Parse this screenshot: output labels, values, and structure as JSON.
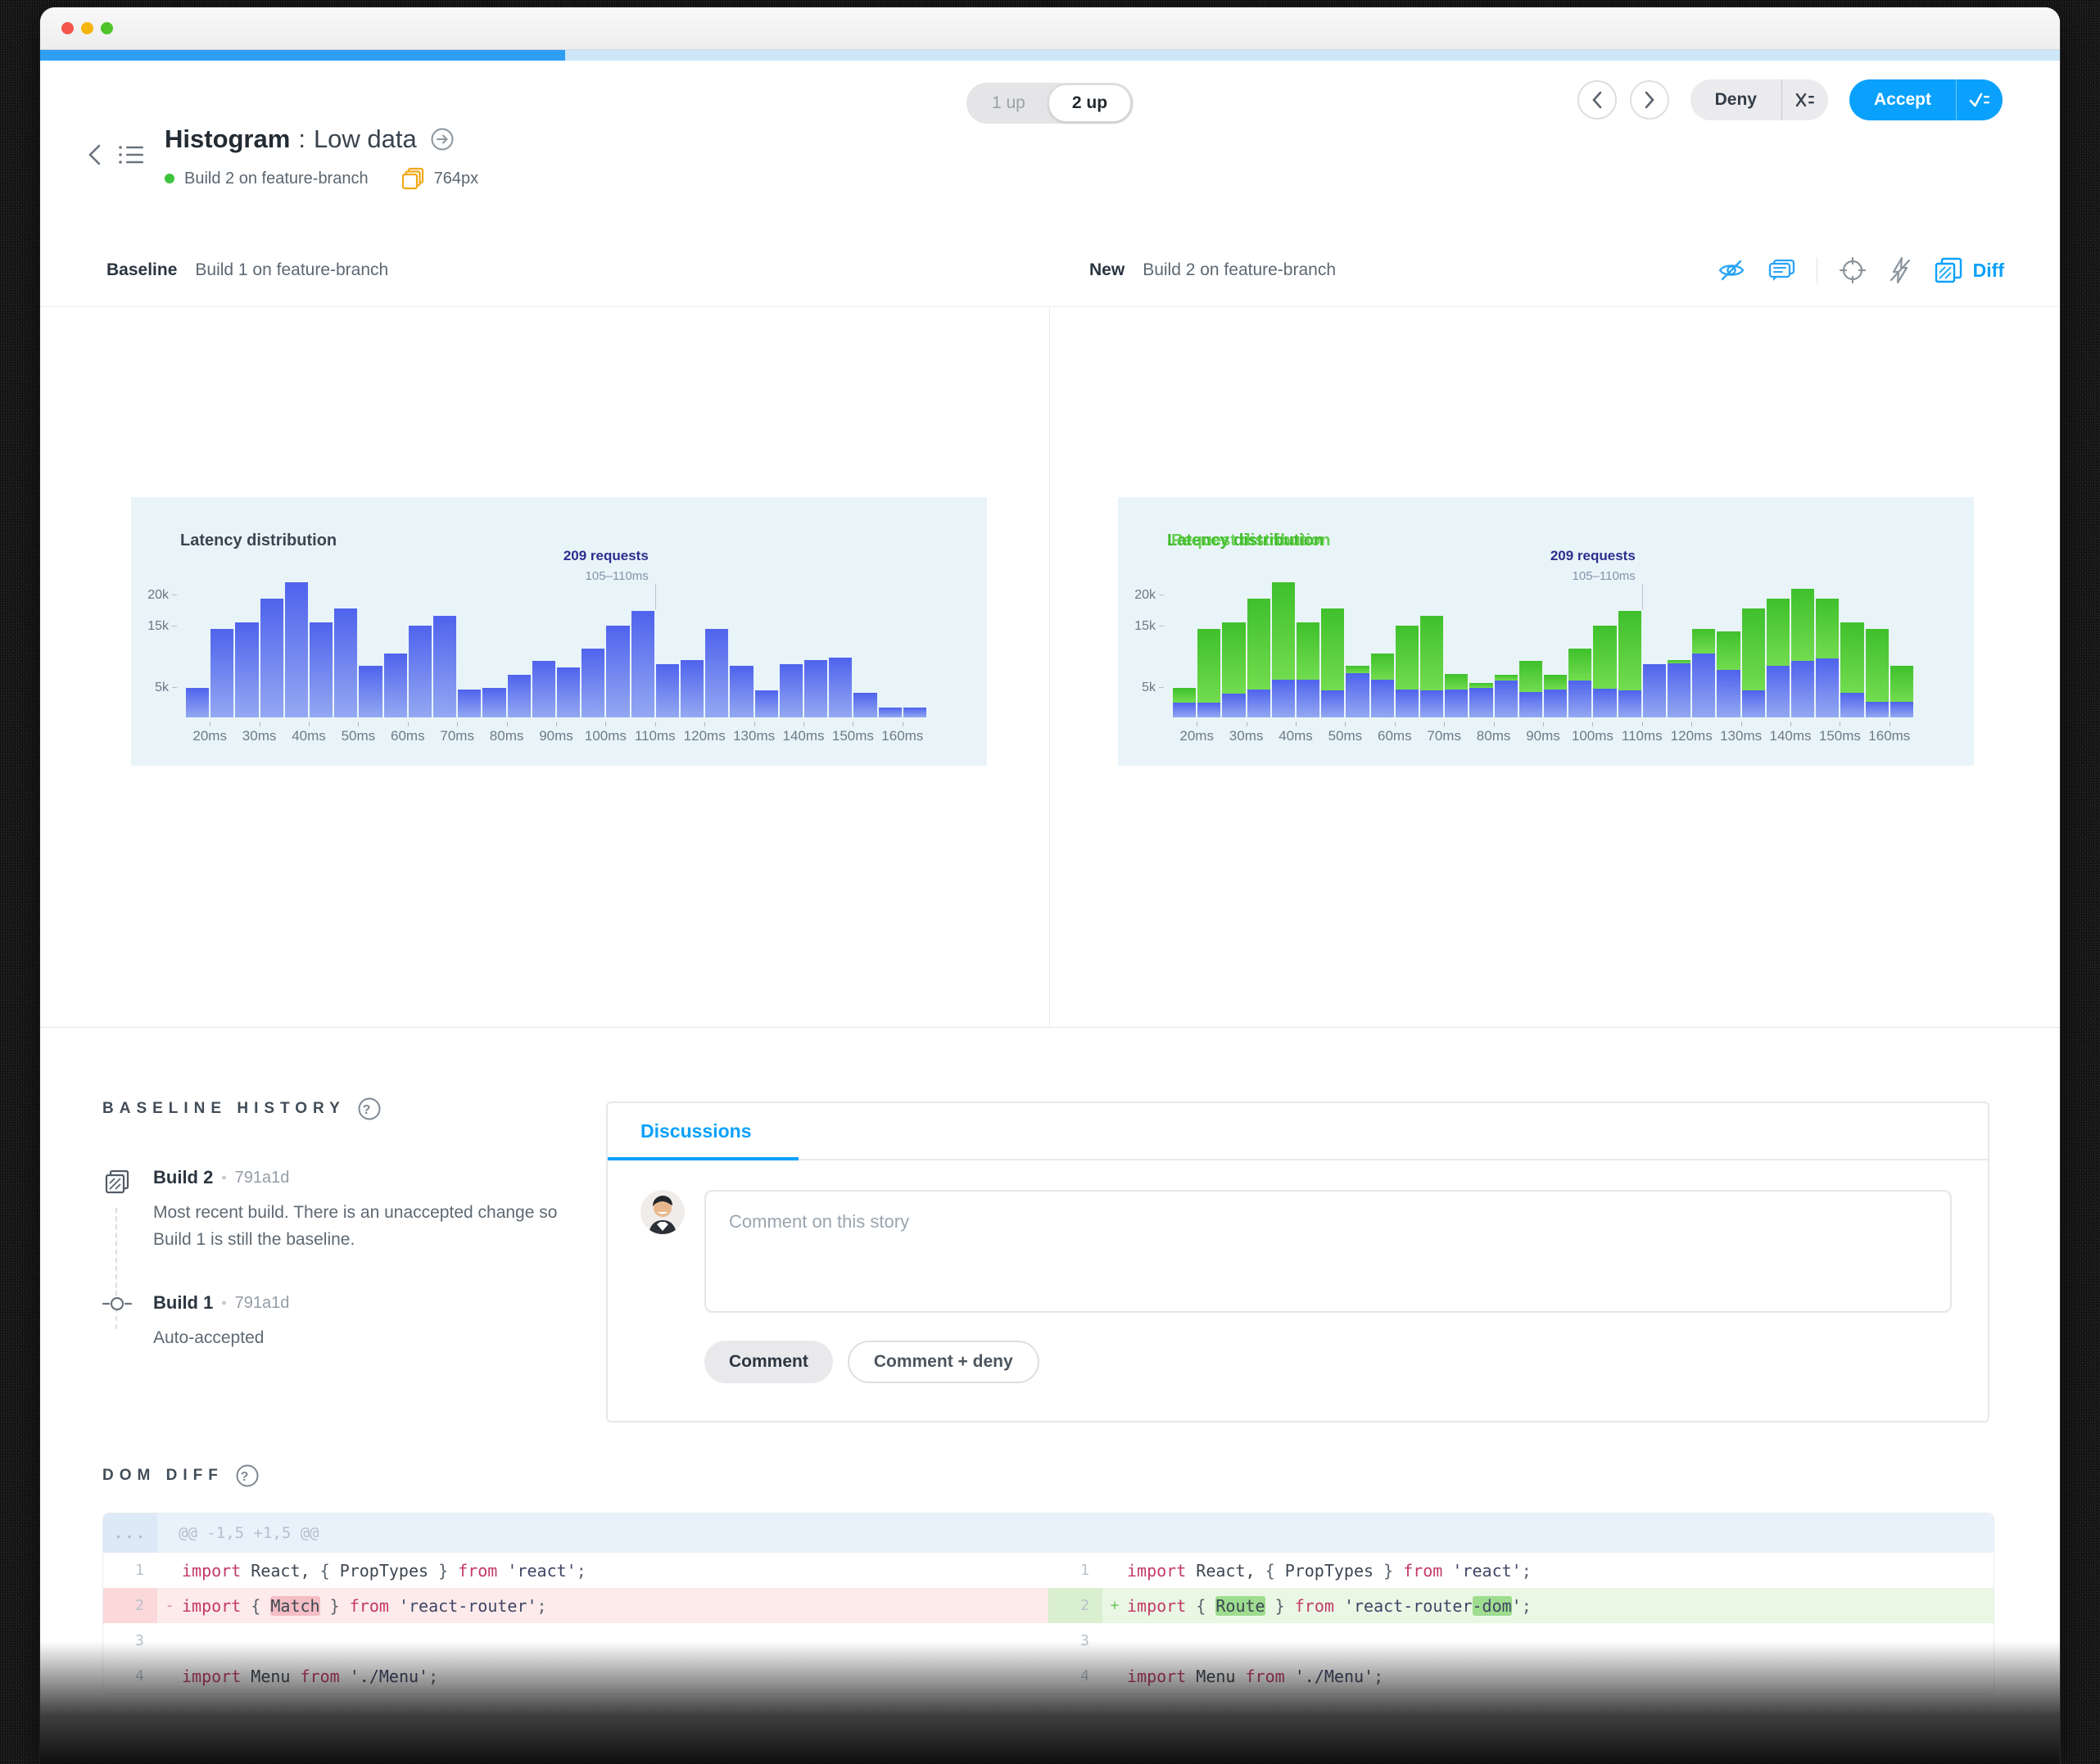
{
  "window": {
    "progress_percent": 26
  },
  "header": {
    "title": "Histogram",
    "separator": ":",
    "variant": "Low data",
    "build_label": "Build 2 on feature-branch",
    "width_label": "764px",
    "toggle": {
      "options": [
        "1 up",
        "2 up"
      ],
      "selected": "2 up"
    },
    "deny_label": "Deny",
    "accept_label": "Accept"
  },
  "compare": {
    "baseline": {
      "label": "Baseline",
      "build": "Build 1 on feature-branch"
    },
    "new": {
      "label": "New",
      "build": "Build 2 on feature-branch"
    },
    "diff_label": "Diff"
  },
  "chart_data": [
    {
      "type": "bar",
      "title": "Latency distribution",
      "x_start_ms": 15,
      "bin_width_ms": 5,
      "x_tick_labels": [
        "20ms",
        "30ms",
        "40ms",
        "50ms",
        "60ms",
        "70ms",
        "80ms",
        "90ms",
        "100ms",
        "110ms",
        "120ms",
        "130ms",
        "140ms",
        "150ms",
        "160ms"
      ],
      "y_ticks": [
        {
          "label": "20k",
          "value": 20
        },
        {
          "label": "15k",
          "value": 15
        },
        {
          "label": "5k",
          "value": 5
        }
      ],
      "ylim_k": [
        0,
        23
      ],
      "values_k": [
        4.8,
        14.4,
        15.5,
        19.4,
        22,
        15.5,
        17.8,
        8.4,
        10.4,
        14.9,
        16.5,
        4.5,
        4.8,
        7,
        9.2,
        8.1,
        11.2,
        14.9,
        17.3,
        8.7,
        9.3,
        14.4,
        8.4,
        4.4,
        8.7,
        9.3,
        9.7,
        4,
        1.6,
        1.6
      ],
      "annotation": {
        "label": "209 requests",
        "sublabel": "105–110ms",
        "bar_index": 18
      }
    },
    {
      "type": "stacked-bar",
      "title": "Latency distribution",
      "title_overlay": "Request distribution",
      "x_start_ms": 15,
      "bin_width_ms": 5,
      "x_tick_labels": [
        "20ms",
        "30ms",
        "40ms",
        "50ms",
        "60ms",
        "70ms",
        "80ms",
        "90ms",
        "100ms",
        "110ms",
        "120ms",
        "130ms",
        "140ms",
        "150ms",
        "160ms"
      ],
      "y_ticks": [
        {
          "label": "20k",
          "value": 20
        },
        {
          "label": "15k",
          "value": 15
        },
        {
          "label": "5k",
          "value": 5
        }
      ],
      "ylim_k": [
        0,
        23
      ],
      "series": [
        {
          "name": "new-build-bars",
          "color_key": "bar_blue",
          "base_k": [
            2.4,
            2.4,
            3.9,
            4.6,
            6.1,
            6.1,
            4.4,
            7.2,
            6.1,
            4.6,
            4.4,
            4.5,
            4.8,
            6,
            4.1,
            4.6,
            6,
            4.7,
            4.4,
            8.7,
            8.8,
            10.4,
            7.8,
            4.4,
            8.4,
            9.2,
            9.6,
            4,
            2.6,
            2.6
          ]
        },
        {
          "name": "diff-highlight",
          "color_key": "diff_green",
          "totals_k": [
            4.8,
            14.4,
            15.5,
            19.4,
            22,
            15.5,
            17.8,
            8.4,
            10.4,
            14.9,
            16.5,
            7,
            5.6,
            7,
            9.2,
            7,
            11.2,
            14.9,
            17.3,
            8.7,
            9.3,
            14.4,
            14,
            17.8,
            19.4,
            21,
            19.4,
            15.5,
            14.4,
            8.4
          ]
        }
      ],
      "annotation": {
        "label": "209 requests",
        "sublabel": "105–110ms",
        "bar_index": 18
      }
    }
  ],
  "baseline_history": {
    "heading": "BASELINE HISTORY",
    "items": [
      {
        "name": "Build 2",
        "sha": "791a1d",
        "description": "Most recent build. There is an unaccepted change so Build 1 is still the baseline."
      },
      {
        "name": "Build 1",
        "sha": "791a1d",
        "description": "Auto-accepted"
      }
    ]
  },
  "discussions": {
    "tab_label": "Discussions",
    "placeholder": "Comment on this story",
    "comment_label": "Comment",
    "comment_deny_label": "Comment + deny"
  },
  "dom_diff": {
    "heading": "DOM DIFF",
    "gutter_ellipsis": "...",
    "hunk_header": "@@ -1,5 +1,5 @@",
    "left_lines": [
      {
        "num": "1",
        "type": "context",
        "tokens": [
          {
            "c": "kw",
            "v": "import "
          },
          {
            "c": "id",
            "v": "React, "
          },
          {
            "c": "pu",
            "v": "{ "
          },
          {
            "c": "id",
            "v": "PropTypes"
          },
          {
            "c": "pu",
            "v": " } "
          },
          {
            "c": "kw",
            "v": "from "
          },
          {
            "c": "str",
            "v": "'react'"
          },
          {
            "c": "pu",
            "v": ";"
          }
        ]
      },
      {
        "num": "2",
        "type": "removed",
        "marker": "-",
        "tokens": [
          {
            "c": "kw",
            "v": "import "
          },
          {
            "c": "pu",
            "v": "{ "
          },
          {
            "c": "id",
            "v": "Match",
            "hl": "red"
          },
          {
            "c": "pu",
            "v": " } "
          },
          {
            "c": "kw",
            "v": "from "
          },
          {
            "c": "str",
            "v": "'react-router'"
          },
          {
            "c": "pu",
            "v": ";"
          }
        ]
      },
      {
        "num": "3",
        "type": "context",
        "tokens": []
      },
      {
        "num": "4",
        "type": "context",
        "tokens": [
          {
            "c": "kw",
            "v": "import "
          },
          {
            "c": "id",
            "v": "Menu "
          },
          {
            "c": "kw",
            "v": "from "
          },
          {
            "c": "str",
            "v": "'./Menu'"
          },
          {
            "c": "pu",
            "v": ";"
          }
        ]
      }
    ],
    "right_lines": [
      {
        "num": "1",
        "type": "context",
        "tokens": [
          {
            "c": "kw",
            "v": "import "
          },
          {
            "c": "id",
            "v": "React, "
          },
          {
            "c": "pu",
            "v": "{ "
          },
          {
            "c": "id",
            "v": "PropTypes"
          },
          {
            "c": "pu",
            "v": " } "
          },
          {
            "c": "kw",
            "v": "from "
          },
          {
            "c": "str",
            "v": "'react'"
          },
          {
            "c": "pu",
            "v": ";"
          }
        ]
      },
      {
        "num": "2",
        "type": "added",
        "marker": "+",
        "tokens": [
          {
            "c": "kw",
            "v": "import "
          },
          {
            "c": "pu",
            "v": "{ "
          },
          {
            "c": "id",
            "v": "Route",
            "hl": "green"
          },
          {
            "c": "pu",
            "v": " } "
          },
          {
            "c": "kw",
            "v": "from "
          },
          {
            "c": "str",
            "v": "'react-router"
          },
          {
            "c": "str",
            "v": "-dom",
            "hl": "green"
          },
          {
            "c": "str",
            "v": "'"
          },
          {
            "c": "pu",
            "v": ";"
          }
        ]
      },
      {
        "num": "3",
        "type": "context",
        "tokens": []
      },
      {
        "num": "4",
        "type": "context",
        "tokens": [
          {
            "c": "kw",
            "v": "import "
          },
          {
            "c": "id",
            "v": "Menu "
          },
          {
            "c": "kw",
            "v": "from "
          },
          {
            "c": "str",
            "v": "'./Menu'"
          },
          {
            "c": "pu",
            "v": ";"
          }
        ]
      }
    ]
  },
  "colors": {
    "accent_blue": "#0aa1fc",
    "bar_blue": "#5f73ee",
    "diff_green": "#55c838",
    "chart_background": "#e9f4f9",
    "removed_bg": "#fdeaea",
    "added_bg": "#e9f7e4",
    "annotation_indigo": "#2c2f8e"
  }
}
